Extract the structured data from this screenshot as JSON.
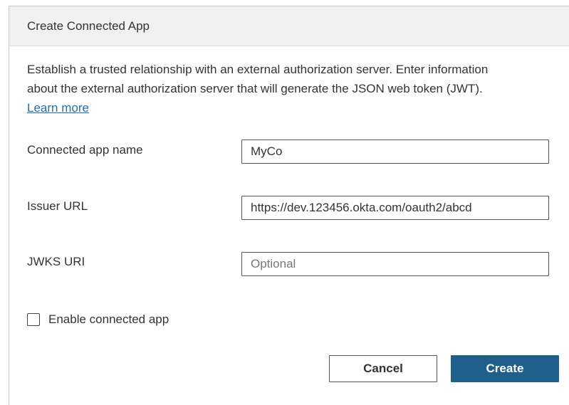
{
  "dialog": {
    "title": "Create Connected App",
    "description_line1": "Establish a trusted relationship with an external authorization server. Enter information",
    "description_line2": "about the external authorization server that will generate the JSON web token (JWT).",
    "learn_more": "Learn more"
  },
  "form": {
    "app_name": {
      "label": "Connected app name",
      "value": "MyCo",
      "placeholder": ""
    },
    "issuer_url": {
      "label": "Issuer URL",
      "value": "https://dev.123456.okta.com/oauth2/abcd",
      "placeholder": ""
    },
    "jwks_uri": {
      "label": "JWKS URI",
      "value": "",
      "placeholder": "Optional"
    },
    "enable_checkbox": {
      "label": "Enable connected app",
      "checked": false
    }
  },
  "buttons": {
    "cancel": "Cancel",
    "create": "Create"
  },
  "colors": {
    "accent": "#1f5f8b",
    "link": "#1f6fab",
    "header_bg": "#f1f1f1"
  }
}
